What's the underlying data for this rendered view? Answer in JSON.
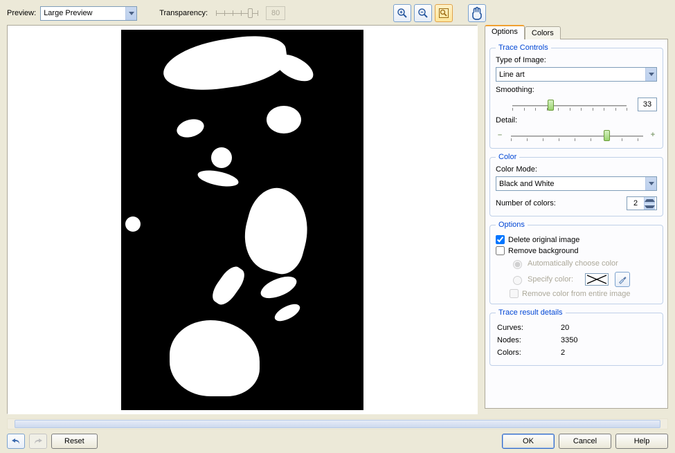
{
  "toolbar": {
    "preview_label": "Preview:",
    "preview_select": "Large Preview",
    "transparency_label": "Transparency:",
    "transparency_value": "80"
  },
  "tabs": {
    "options": "Options",
    "colors": "Colors"
  },
  "trace_controls": {
    "legend": "Trace Controls",
    "type_label": "Type of Image:",
    "type_value": "Line art",
    "smoothing_label": "Smoothing:",
    "smoothing_value": "33",
    "detail_label": "Detail:"
  },
  "color": {
    "legend": "Color",
    "mode_label": "Color Mode:",
    "mode_value": "Black and White",
    "num_label": "Number of colors:",
    "num_value": "2"
  },
  "options": {
    "legend": "Options",
    "delete_original": "Delete original image",
    "remove_background": "Remove background",
    "auto_color": "Automatically choose color",
    "specify_color": "Specify color:",
    "remove_entire": "Remove color from entire image"
  },
  "results": {
    "legend": "Trace result details",
    "curves_label": "Curves:",
    "curves_value": "20",
    "nodes_label": "Nodes:",
    "nodes_value": "3350",
    "colors_label": "Colors:",
    "colors_value": "2"
  },
  "bottom": {
    "reset": "Reset",
    "ok": "OK",
    "cancel": "Cancel",
    "help": "Help"
  }
}
